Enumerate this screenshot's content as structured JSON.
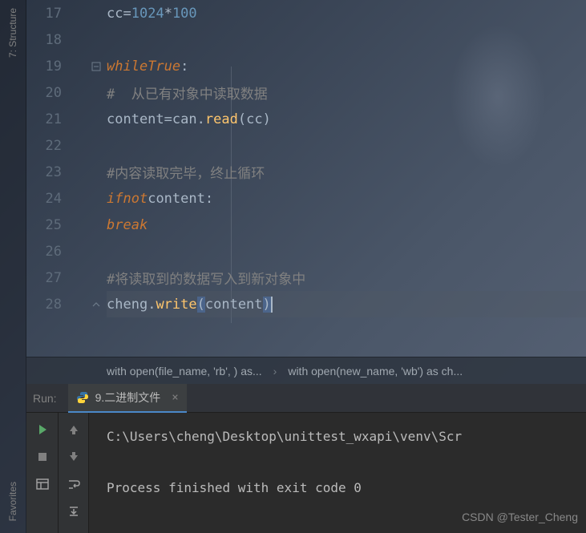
{
  "sidebar": {
    "structure_label": "7: Structure",
    "favorites_label": "Favorites"
  },
  "editor": {
    "lines": [
      {
        "num": "17"
      },
      {
        "num": "18"
      },
      {
        "num": "19"
      },
      {
        "num": "20"
      },
      {
        "num": "21"
      },
      {
        "num": "22"
      },
      {
        "num": "23"
      },
      {
        "num": "24"
      },
      {
        "num": "25"
      },
      {
        "num": "26"
      },
      {
        "num": "27"
      },
      {
        "num": "28"
      }
    ],
    "tokens": {
      "l17_1": "cc",
      "l17_2": "=",
      "l17_3": "1024",
      "l17_4": "*",
      "l17_5": "100",
      "l19_1": "while",
      "l19_2": "True",
      "l19_3": ":",
      "l20_1": "#  从已有对象中读取数据",
      "l21_1": "content",
      "l21_2": "=",
      "l21_3": "can",
      "l21_4": ".",
      "l21_5": "read",
      "l21_6": "(",
      "l21_7": "cc",
      "l21_8": ")",
      "l23_1": "#内容读取完毕，终止循环",
      "l24_1": "if",
      "l24_2": "not",
      "l24_3": "content",
      "l24_4": ":",
      "l25_1": "break",
      "l27_1": "#将读取到的数据写入到新对象中",
      "l28_1": "cheng",
      "l28_2": ".",
      "l28_3": "write",
      "l28_4": "(",
      "l28_5": "content",
      "l28_6": ")"
    }
  },
  "breadcrumb": {
    "item1": "with open(file_name, 'rb', ) as...",
    "item2": "with open(new_name, 'wb') as ch..."
  },
  "run": {
    "label": "Run:",
    "tab_name": "9.二进制文件",
    "console_line1": "C:\\Users\\cheng\\Desktop\\unittest_wxapi\\venv\\Scr",
    "console_line2": "Process finished with exit code 0"
  },
  "watermark": "CSDN @Tester_Cheng"
}
